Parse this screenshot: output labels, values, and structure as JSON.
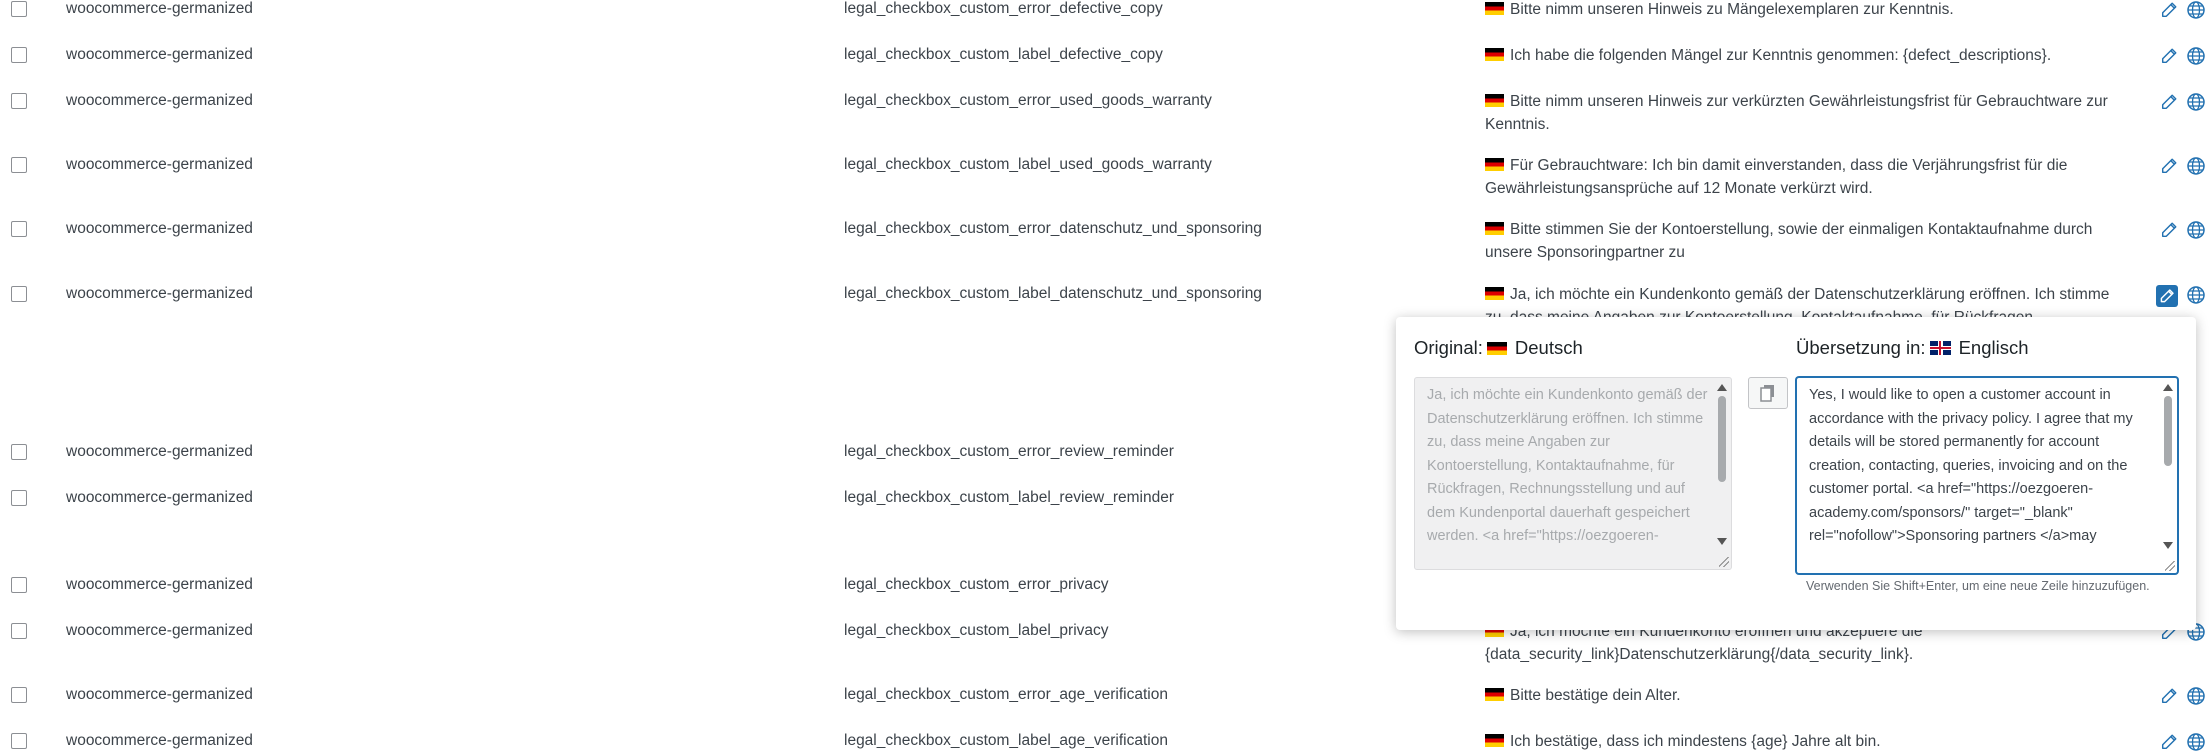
{
  "rows": [
    {
      "plugin": "woocommerce-germanized",
      "key": "legal_checkbox_custom_error_defective_copy",
      "text": "Bitte nimm unseren Hinweis zu Mängelexemplaren zur Kenntnis."
    },
    {
      "plugin": "woocommerce-germanized",
      "key": "legal_checkbox_custom_label_defective_copy",
      "text": "Ich habe die folgenden Mängel zur Kenntnis genommen: {defect_descriptions}."
    },
    {
      "plugin": "woocommerce-germanized",
      "key": "legal_checkbox_custom_error_used_goods_warranty",
      "text": "Bitte nimm unseren Hinweis zur verkürzten Gewährleistungsfrist für Gebrauchtware zur Kenntnis."
    },
    {
      "plugin": "woocommerce-germanized",
      "key": "legal_checkbox_custom_label_used_goods_warranty",
      "text": "Für Gebrauchtware: Ich bin damit einverstanden, dass die Verjährungsfrist für die Gewährleistungsansprüche auf 12 Monate verkürzt wird."
    },
    {
      "plugin": "woocommerce-germanized",
      "key": "legal_checkbox_custom_error_datenschutz_und_sponsoring",
      "text": "Bitte stimmen Sie der Kontoerstellung, sowie der einmaligen Kontaktaufnahme durch unsere Sponsoringpartner zu"
    },
    {
      "plugin": "woocommerce-germanized",
      "key": "legal_checkbox_custom_label_datenschutz_und_sponsoring",
      "text": "Ja, ich möchte ein Kundenkonto gemäß der Datenschutzerklärung eröffnen. Ich stimme zu, dass meine Angaben zur Kontoerstellung, Kontaktaufnahme, für Rückfragen"
    },
    {
      "plugin": "woocommerce-germanized",
      "key": "legal_checkbox_custom_error_review_reminder",
      "text": ""
    },
    {
      "plugin": "woocommerce-germanized",
      "key": "legal_checkbox_custom_label_review_reminder",
      "text": ""
    },
    {
      "plugin": "woocommerce-germanized",
      "key": "legal_checkbox_custom_error_privacy",
      "text": ""
    },
    {
      "plugin": "woocommerce-germanized",
      "key": "legal_checkbox_custom_label_privacy",
      "text": "Ja, ich möchte ein Kundenkonto eröffnen und akzeptiere die {data_security_link}Datenschutzerklärung{/data_security_link}."
    },
    {
      "plugin": "woocommerce-germanized",
      "key": "legal_checkbox_custom_error_age_verification",
      "text": "Bitte bestätige dein Alter."
    },
    {
      "plugin": "woocommerce-germanized",
      "key": "legal_checkbox_custom_label_age_verification",
      "text": "Ich bestätige, dass ich mindestens {age} Jahre alt bin."
    }
  ],
  "popup": {
    "original_label": "Original:",
    "original_lang": "Deutsch",
    "translation_label": "Übersetzung in:",
    "translation_lang": "Englisch",
    "original_text": "Ja, ich möchte ein Kundenkonto gemäß der Datenschutzerklärung eröffnen. Ich stimme zu, dass meine Angaben zur Kontoerstellung, Kontaktaufnahme, für Rückfragen, Rechnungsstellung und auf dem Kundenportal dauerhaft gespeichert werden. <a href=\"https://oezgoeren-",
    "translation_text": "Yes, I would like to open a customer account in accordance with the privacy policy. I agree that my details will be stored permanently for account creation, contacting, queries, invoicing and on the customer portal. <a href=\"https://oezgoeren-academy.com/sponsors/\" target=\"_blank\" rel=\"nofollow\">Sponsoring partners </a>may",
    "hint": "Verwenden Sie Shift+Enter, um eine neue Zeile hinzuzufügen."
  },
  "icons": {
    "edit": "pencil-icon",
    "globe": "globe-icon",
    "copy": "copy-icon"
  },
  "colors": {
    "accent": "#2271b1",
    "text": "#3c434a",
    "muted": "#a7aaad"
  }
}
